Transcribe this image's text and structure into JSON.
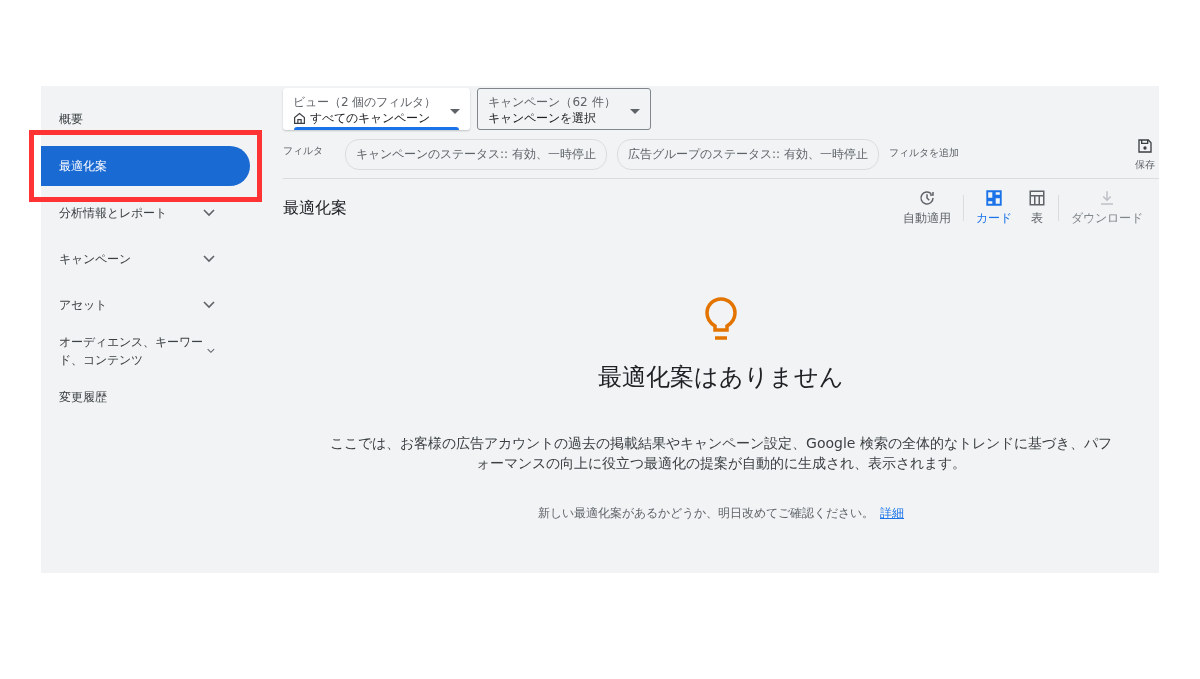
{
  "sidebar": {
    "items": [
      {
        "label": "概要",
        "selected": false,
        "expandable": false,
        "highlighted": false
      },
      {
        "label": "最適化案",
        "selected": true,
        "expandable": false,
        "highlighted": true
      },
      {
        "label": "分析情報とレポート",
        "selected": false,
        "expandable": true,
        "highlighted": false
      },
      {
        "label": "キャンペーン",
        "selected": false,
        "expandable": true,
        "highlighted": false
      },
      {
        "label": "アセット",
        "selected": false,
        "expandable": true,
        "highlighted": false
      },
      {
        "label": "オーディエンス、キーワード、コンテンツ",
        "selected": false,
        "expandable": true,
        "highlighted": false
      },
      {
        "label": "変更履歴",
        "selected": false,
        "expandable": false,
        "highlighted": false
      }
    ]
  },
  "view_selector": {
    "label": "ビュー（2 個のフィルタ）",
    "value": "すべてのキャンペーン"
  },
  "campaign_selector": {
    "label": "キャンペーン（62 件）",
    "value": "キャンペーンを選択"
  },
  "filters": {
    "label": "フィルタ",
    "chips": [
      "キャンペーンのステータス:: 有効、一時停止",
      "広告グループのステータス:: 有効、一時停止"
    ],
    "add": "フィルタを追加",
    "save": "保存"
  },
  "header": {
    "title": "最適化案",
    "tools": [
      {
        "label": "自動適用",
        "selected": false,
        "disabled": false
      },
      {
        "label": "カード",
        "selected": true,
        "disabled": false
      },
      {
        "label": "表",
        "selected": false,
        "disabled": false
      },
      {
        "label": "ダウンロード",
        "selected": false,
        "disabled": true
      }
    ]
  },
  "empty_state": {
    "title": "最適化案はありません",
    "description": "ここでは、お客様の広告アカウントの過去の掲載結果やキャンペーン設定、Google 検索の全体的なトレンドに基づき、パフォーマンスの向上に役立つ最適化の提案が自動的に生成され、表示されます。",
    "note": "新しい最適化案があるかどうか、明日改めてご確認ください。",
    "link": "詳細"
  }
}
